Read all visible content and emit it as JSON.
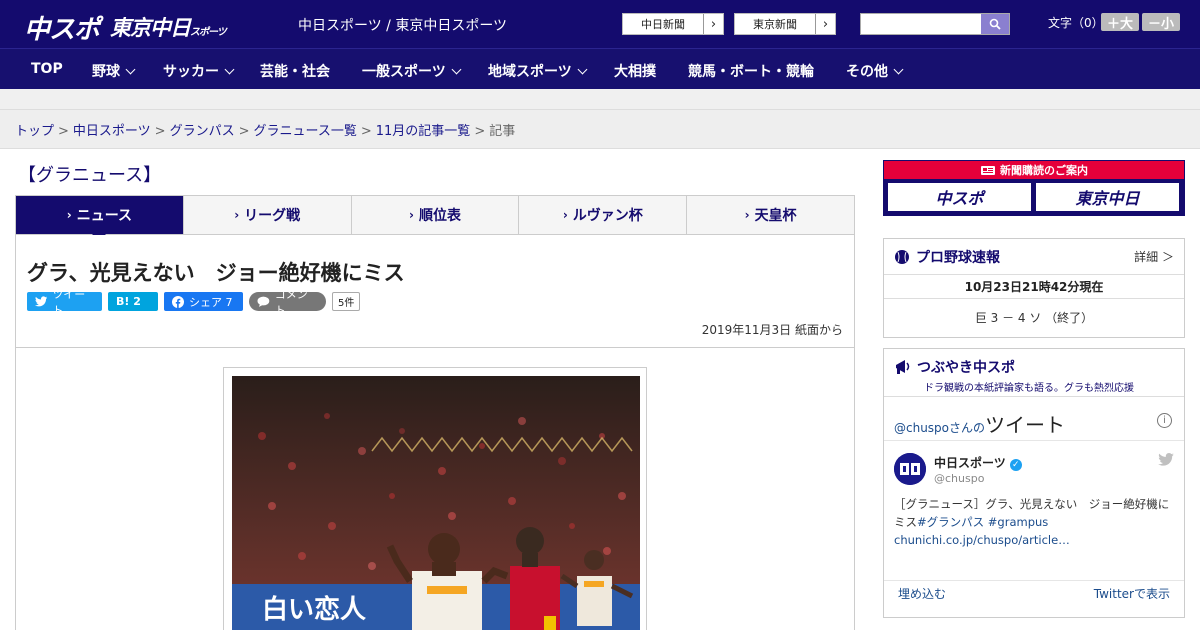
{
  "header": {
    "logo_main": "中スポ",
    "logo_tokyo": "東京中日",
    "logo_tokyo_sub": "スポーツ",
    "site_title": "中日スポーツ / 東京中日スポーツ",
    "links": [
      "中日新聞",
      "東京新聞"
    ],
    "font_size_label": "文字（0）",
    "font_plus": "＋大",
    "font_minus": "－小",
    "search_placeholder": ""
  },
  "nav": {
    "items": [
      {
        "label": "TOP",
        "dropdown": false
      },
      {
        "label": "野球",
        "dropdown": true
      },
      {
        "label": "サッカー",
        "dropdown": true
      },
      {
        "label": "芸能・社会",
        "dropdown": false
      },
      {
        "label": "一般スポーツ",
        "dropdown": true
      },
      {
        "label": "地域スポーツ",
        "dropdown": true
      },
      {
        "label": "大相撲",
        "dropdown": false
      },
      {
        "label": "競馬・ボート・競輪",
        "dropdown": false
      },
      {
        "label": "その他",
        "dropdown": true
      }
    ]
  },
  "breadcrumb": {
    "items": [
      "トップ",
      "中日スポーツ",
      "グランパス",
      "グラニュース一覧",
      "11月の記事一覧"
    ],
    "current": "記事",
    "separator": ">"
  },
  "section_title": "【グラニュース】",
  "tabs": [
    {
      "label": "ニュース",
      "active": true
    },
    {
      "label": "リーグ戦",
      "active": false
    },
    {
      "label": "順位表",
      "active": false
    },
    {
      "label": "ルヴァン杯",
      "active": false
    },
    {
      "label": "天皇杯",
      "active": false
    }
  ],
  "article": {
    "headline": "グラ、光見えない　ジョー絶好機にミス",
    "share": {
      "tweet": "ツイート",
      "hatena": "B! 2",
      "facebook": "シェア 7",
      "comment": "コメント",
      "comment_count": "5件"
    },
    "date": "2019年11月3日 紙面から",
    "photo_banner_text": "白い恋人"
  },
  "sidebar": {
    "promo": {
      "header": "新聞購読のご案内",
      "left": "中スポ",
      "right": "東京中日"
    },
    "baseball": {
      "title": "プロ野球速報",
      "detail": "詳細 ＞",
      "timestamp": "10月23日21時42分現在",
      "score": "巨 3 － 4 ソ （終了）"
    },
    "tsubuyaki": {
      "title": "つぶやき中スポ",
      "subtitle": "ドラ観戦の本紙評論家も語る。グラも熱烈応援",
      "account_prefix": "@chuspo",
      "account_suffix": "さんの",
      "tweets_label": "ツイート",
      "info": "i",
      "tweet": {
        "name": "中日スポーツ",
        "handle": "@chuspo",
        "text_plain": "［グラニュース］グラ、光見えない　ジョー絶好機にミス",
        "tags": "#グランパス #grampus",
        "link": "chunichi.co.jp/chuspo/article…"
      },
      "embed": "埋め込む",
      "view_on": "Twitterで表示"
    }
  },
  "colors": {
    "header_bg": "#140b6e",
    "accent_red": "#e5003a",
    "twitter": "#1da1f2",
    "facebook": "#1877f2",
    "hatena": "#00a4de"
  }
}
